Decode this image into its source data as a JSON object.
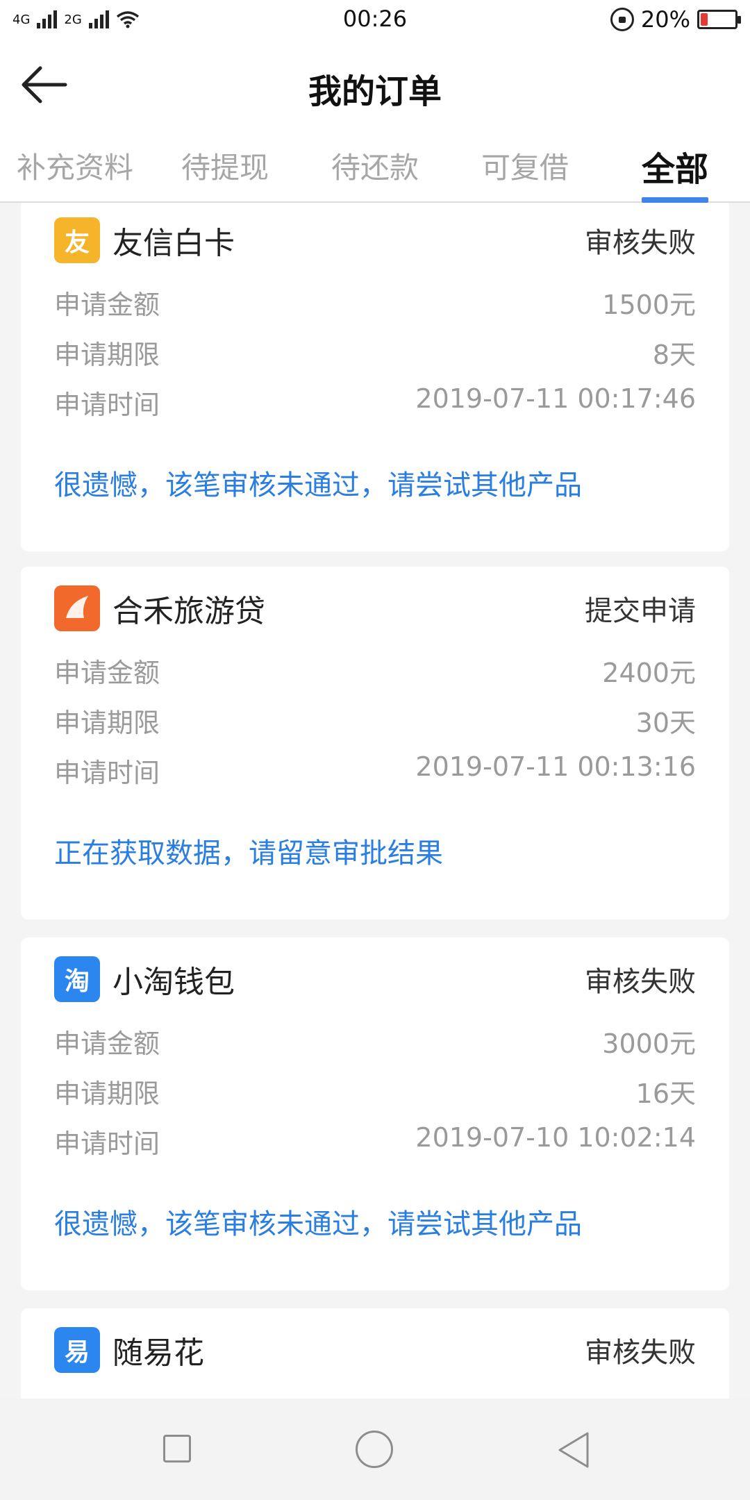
{
  "status_bar": {
    "net1": "4G",
    "net2": "2G",
    "time": "00:26",
    "battery_text": "20%",
    "battery_level": 0.2,
    "battery_color": "#e53935"
  },
  "header": {
    "title": "我的订单"
  },
  "tabs": [
    {
      "label": "补充资料",
      "active": false
    },
    {
      "label": "待提现",
      "active": false
    },
    {
      "label": "待还款",
      "active": false
    },
    {
      "label": "可复借",
      "active": false
    },
    {
      "label": "全部",
      "active": true
    }
  ],
  "accent_color": "#3d86e8",
  "orders": [
    {
      "logo_icon": "you-logo-icon",
      "logo_char": "友",
      "logo_color": "#f5b42a",
      "product": "友信白卡",
      "status": "审核失败",
      "amount_label": "申请金额",
      "amount": "1500元",
      "term_label": "申请期限",
      "term": "8天",
      "time_label": "申请时间",
      "time": "2019-07-11 00:17:46",
      "note": "很遗憾，该笔审核未通过，请尝试其他产品"
    },
    {
      "logo_icon": "hehe-travel-logo-icon",
      "logo_char": "",
      "logo_color": "#f26a2b",
      "product": "合禾旅游贷",
      "status": "提交申请",
      "amount_label": "申请金额",
      "amount": "2400元",
      "term_label": "申请期限",
      "term": "30天",
      "time_label": "申请时间",
      "time": "2019-07-11 00:13:16",
      "note": "正在获取数据，请留意审批结果"
    },
    {
      "logo_icon": "tao-logo-icon",
      "logo_char": "淘",
      "logo_color": "#2c86f0",
      "product": "小淘钱包",
      "status": "审核失败",
      "amount_label": "申请金额",
      "amount": "3000元",
      "term_label": "申请期限",
      "term": "16天",
      "time_label": "申请时间",
      "time": "2019-07-10 10:02:14",
      "note": "很遗憾，该笔审核未通过，请尝试其他产品"
    },
    {
      "logo_icon": "yi-logo-icon",
      "logo_char": "易",
      "logo_color": "#2c86f0",
      "product": "随易花",
      "status": "审核失败"
    }
  ]
}
